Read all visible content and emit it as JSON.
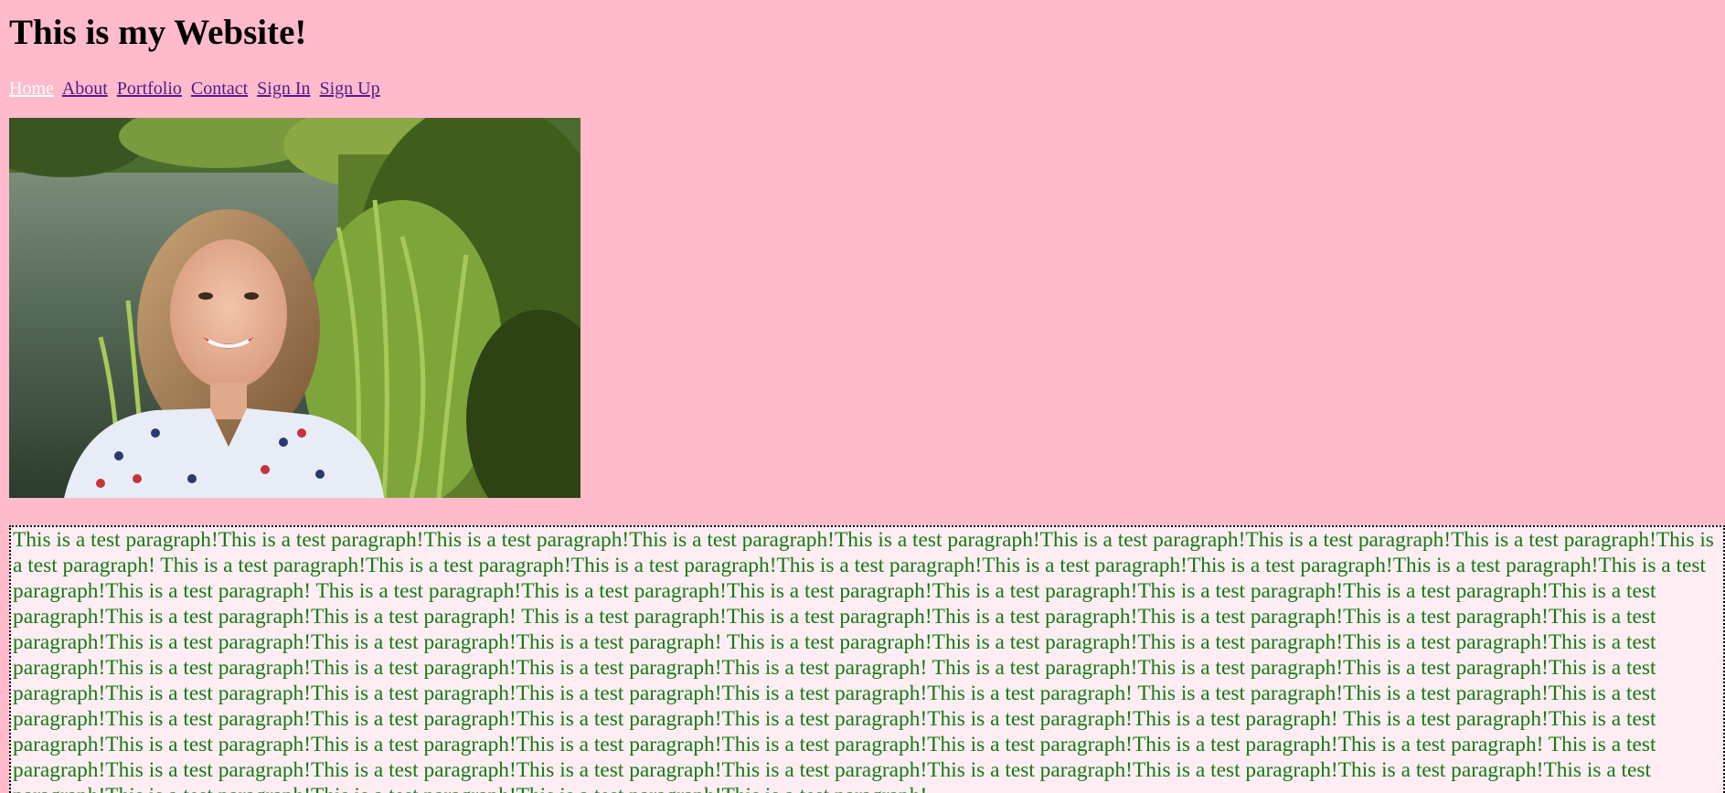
{
  "header": {
    "title": "This is my Website!"
  },
  "nav": {
    "items": [
      {
        "label": "Home",
        "current": true
      },
      {
        "label": "About",
        "current": false
      },
      {
        "label": "Portfolio",
        "current": false
      },
      {
        "label": "Contact",
        "current": false
      },
      {
        "label": "Sign In",
        "current": false
      },
      {
        "label": "Sign Up",
        "current": false
      }
    ]
  },
  "main": {
    "paragraph": "This is a test paragraph!This is a test paragraph!This is a test paragraph!This is a test paragraph!This is a test paragraph!This is a test paragraph!This is a test paragraph!This is a test paragraph!This is a test paragraph! This is a test paragraph!This is a test paragraph!This is a test paragraph!This is a test paragraph!This is a test paragraph!This is a test paragraph!This is a test paragraph!This is a test paragraph!This is a test paragraph! This is a test paragraph!This is a test paragraph!This is a test paragraph!This is a test paragraph!This is a test paragraph!This is a test paragraph!This is a test paragraph!This is a test paragraph!This is a test paragraph! This is a test paragraph!This is a test paragraph!This is a test paragraph!This is a test paragraph!This is a test paragraph!This is a test paragraph!This is a test paragraph!This is a test paragraph!This is a test paragraph! This is a test paragraph!This is a test paragraph!This is a test paragraph!This is a test paragraph!This is a test paragraph!This is a test paragraph!This is a test paragraph!This is a test paragraph!This is a test paragraph! This is a test paragraph!This is a test paragraph!This is a test paragraph!This is a test paragraph!This is a test paragraph!This is a test paragraph!This is a test paragraph!This is a test paragraph!This is a test paragraph! This is a test paragraph!This is a test paragraph!This is a test paragraph!This is a test paragraph!This is a test paragraph!This is a test paragraph!This is a test paragraph!This is a test paragraph!This is a test paragraph! This is a test paragraph!This is a test paragraph!This is a test paragraph!This is a test paragraph!This is a test paragraph!This is a test paragraph!This is a test paragraph!This is a test paragraph!This is a test paragraph! This is a test paragraph!This is a test paragraph!This is a test paragraph!This is a test paragraph!This is a test paragraph!This is a test paragraph!This is a test paragraph!This is a test paragraph!This is a test paragraph!This is a test paragraph!This is a test paragraph!This is a test paragraph!This is a test paragraph!"
  },
  "colors": {
    "page_background": "#ffbbcb",
    "paragraph_text": "#137a13",
    "paragraph_background": "#ffedf3",
    "link": "#551a8b",
    "current_link": "#ffffff"
  }
}
